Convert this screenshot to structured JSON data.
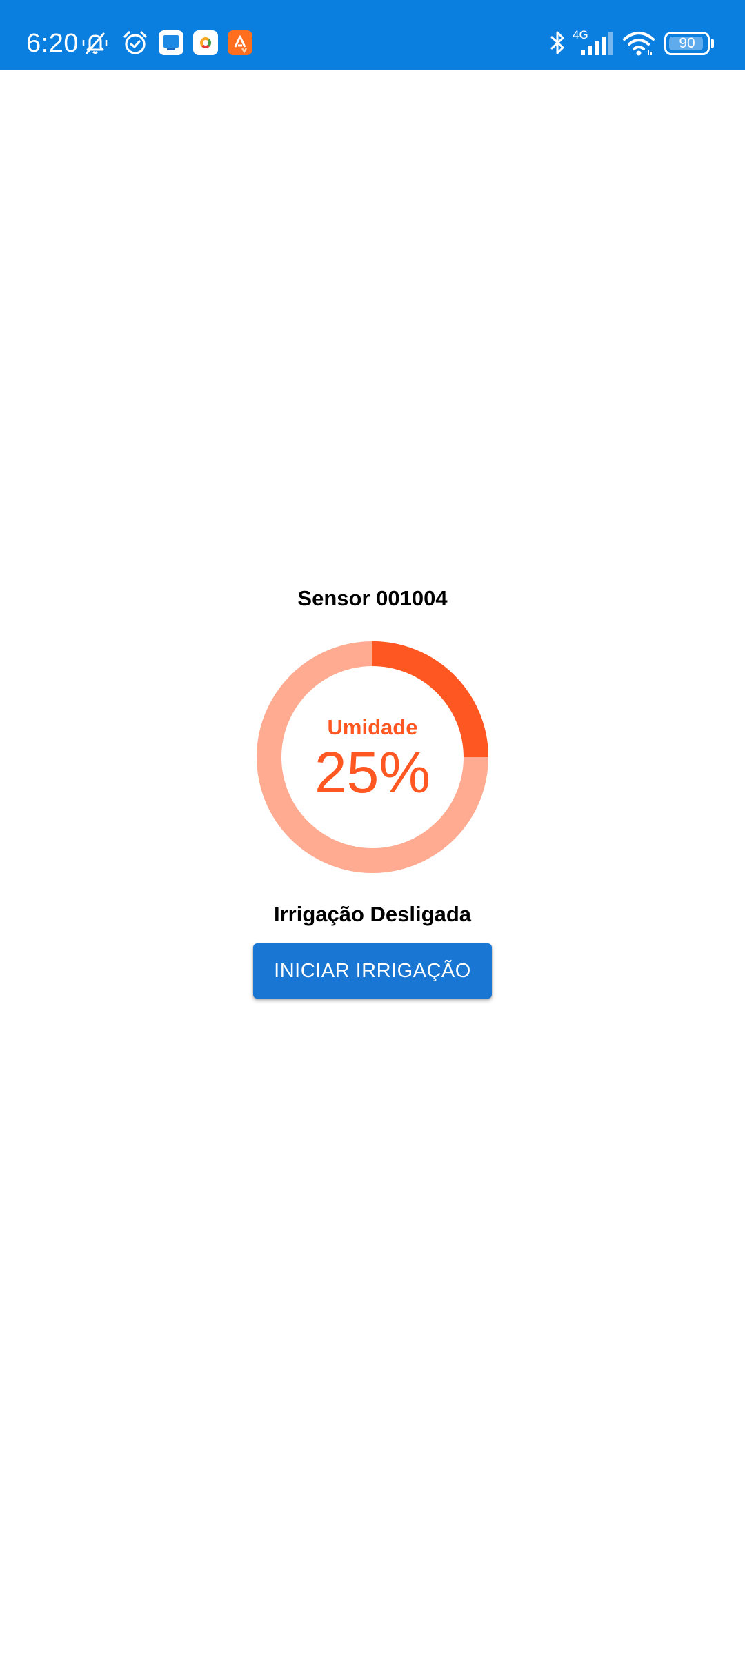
{
  "status_bar": {
    "time": "6:20",
    "network_type": "4G",
    "battery_level": "90",
    "battery_fraction": 0.9,
    "background_color": "#0b7fe0",
    "icons": [
      "mute-icon",
      "alarm-icon",
      "app-notification-icon",
      "app-notification-icon",
      "app-notification-icon",
      "bluetooth-icon",
      "signal-icon",
      "wifi-icon",
      "battery-icon"
    ]
  },
  "sensor": {
    "title": "Sensor 001004"
  },
  "humidity": {
    "label": "Umidade",
    "value_text": "25%",
    "fraction": 0.25,
    "active_color": "#ff5722",
    "track_color": "#ffab91",
    "text_color": "#ff5722"
  },
  "irrigation": {
    "status_text": "Irrigação Desligada",
    "button_label": "INICIAR IRRIGAÇÃO",
    "button_color": "#1976d2"
  }
}
